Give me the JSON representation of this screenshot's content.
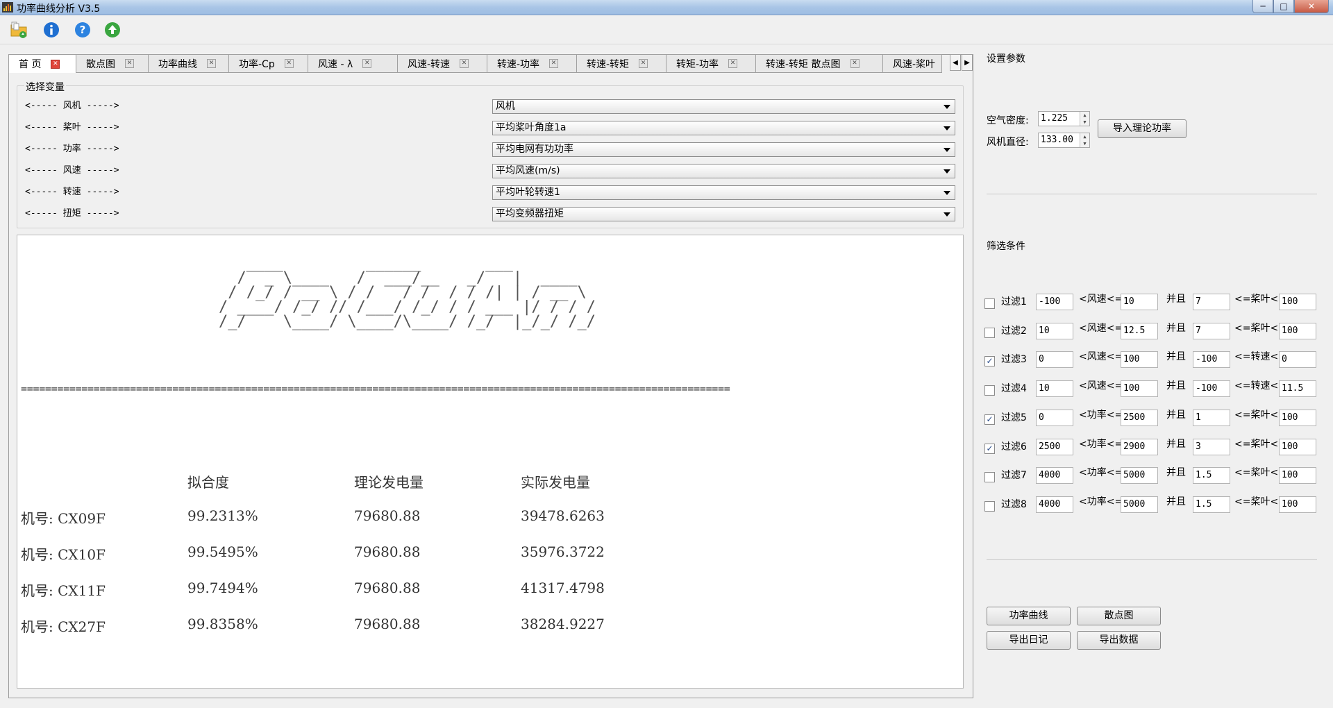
{
  "window": {
    "title": "功率曲线分析 V3.5",
    "minimize": "─",
    "maximize": "□",
    "close": "✕"
  },
  "toolbar": {
    "icons": [
      "open-folder-icon",
      "info-icon",
      "help-icon",
      "upload-icon"
    ]
  },
  "tabs": [
    {
      "label": "首  页",
      "active": true
    },
    {
      "label": "散点图"
    },
    {
      "label": "功率曲线"
    },
    {
      "label": "功率-Cp"
    },
    {
      "label": "风速 - λ"
    },
    {
      "label": "风速-转速"
    },
    {
      "label": "转速-功率"
    },
    {
      "label": "转速-转矩"
    },
    {
      "label": "转矩-功率"
    },
    {
      "label": "转速-转矩 散点图"
    },
    {
      "label": "风速-桨叶"
    }
  ],
  "tab_close_glyph": "✕",
  "tab_scroll": {
    "left": "◀",
    "right": "▶"
  },
  "variables": {
    "group_title": "选择变量",
    "rows": [
      {
        "label": "<----- 风机 ----->",
        "value": "风机"
      },
      {
        "label": "<----- 桨叶 ----->",
        "value": "平均桨叶角度1a"
      },
      {
        "label": "<----- 功率 ----->",
        "value": "平均电网有功功率"
      },
      {
        "label": "<----- 风速 ----->",
        "value": "平均风速(m/s)"
      },
      {
        "label": "<----- 转速 ----->",
        "value": "平均叶轮转速1"
      },
      {
        "label": "<----- 扭矩 ----->",
        "value": "平均变频器扭矩"
      }
    ]
  },
  "output": {
    "ascii_art": "   ____         ______       ___\n  /  _ \\____   /  ___/__   _/   |  ____\n / /_/ / __ \\ / /   / /  / / /| | / __ \\\n/ ____/ /_/ // /___/ /_/ / / ___ |/ / / /\n/_/    \\____/ \\____/\\____/ /_/  |_/_/ /_/",
    "separator": "=====================================================================================================================",
    "headers": [
      "拟合度",
      "理论发电量",
      "实际发电量"
    ],
    "rows": [
      {
        "id": "机号: CX09F",
        "fit": "99.2313%",
        "theory": "79680.88",
        "actual": "39478.6263"
      },
      {
        "id": "机号: CX10F",
        "fit": "99.5495%",
        "theory": "79680.88",
        "actual": "35976.3722"
      },
      {
        "id": "机号: CX11F",
        "fit": "99.7494%",
        "theory": "79680.88",
        "actual": "41317.4798"
      },
      {
        "id": "机号: CX27F",
        "fit": "99.8358%",
        "theory": "79680.88",
        "actual": "38284.9227"
      }
    ]
  },
  "settings": {
    "title": "设置参数",
    "air_density_label": "空气密度:",
    "air_density": "1.225",
    "diameter_label": "风机直径:",
    "diameter": "133.00",
    "import_button": "导入理论功率"
  },
  "filters": {
    "title": "筛选条件",
    "and_label": "并且",
    "rows": [
      {
        "label": "过滤1",
        "checked": false,
        "min": "-100",
        "var1": "<风速<=",
        "max": "10",
        "min2": "7",
        "var2": "<=桨叶<",
        "max2": "100"
      },
      {
        "label": "过滤2",
        "checked": false,
        "min": "10",
        "var1": "<风速<=",
        "max": "12.5",
        "min2": "7",
        "var2": "<=桨叶<",
        "max2": "100"
      },
      {
        "label": "过滤3",
        "checked": true,
        "min": "0",
        "var1": "<风速<=",
        "max": "100",
        "min2": "-100",
        "var2": "<=转速<",
        "max2": "0"
      },
      {
        "label": "过滤4",
        "checked": false,
        "min": "10",
        "var1": "<风速<=",
        "max": "100",
        "min2": "-100",
        "var2": "<=转速<",
        "max2": "11.5"
      },
      {
        "label": "过滤5",
        "checked": true,
        "min": "0",
        "var1": "<功率<=",
        "max": "2500",
        "min2": "1",
        "var2": "<=桨叶<",
        "max2": "100"
      },
      {
        "label": "过滤6",
        "checked": true,
        "min": "2500",
        "var1": "<功率<=",
        "max": "2900",
        "min2": "3",
        "var2": "<=桨叶<",
        "max2": "100"
      },
      {
        "label": "过滤7",
        "checked": false,
        "min": "4000",
        "var1": "<功率<=",
        "max": "5000",
        "min2": "1.5",
        "var2": "<=桨叶<",
        "max2": "100"
      },
      {
        "label": "过滤8",
        "checked": false,
        "min": "4000",
        "var1": "<功率<=",
        "max": "5000",
        "min2": "1.5",
        "var2": "<=桨叶<",
        "max2": "100"
      }
    ]
  },
  "actions": {
    "power_curve": "功率曲线",
    "scatter": "散点图",
    "export_log": "导出日记",
    "export_data": "导出数据"
  }
}
